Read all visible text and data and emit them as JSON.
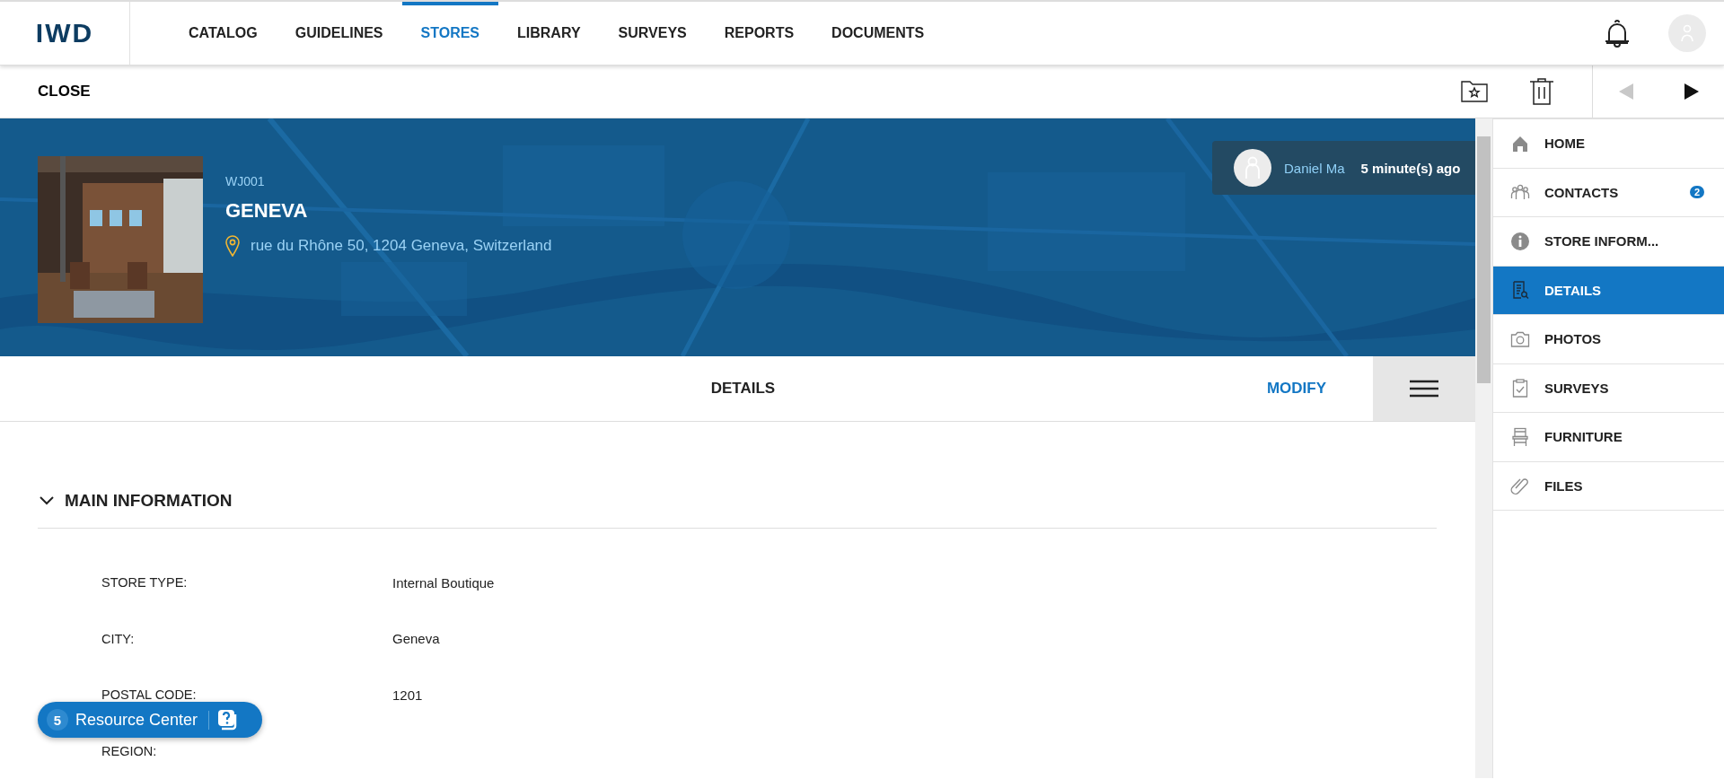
{
  "logo": "IWD",
  "nav": [
    {
      "label": "CATALOG",
      "selected": false
    },
    {
      "label": "GUIDELINES",
      "selected": false
    },
    {
      "label": "STORES",
      "selected": true
    },
    {
      "label": "LIBRARY",
      "selected": false
    },
    {
      "label": "SURVEYS",
      "selected": false
    },
    {
      "label": "REPORTS",
      "selected": false
    },
    {
      "label": "DOCUMENTS",
      "selected": false
    }
  ],
  "toolbar": {
    "close": "CLOSE",
    "previous": {
      "disabled": true
    },
    "next": {
      "disabled": false
    }
  },
  "store": {
    "code": "WJ001",
    "name": "GENEVA",
    "address": "rue du Rhône 50, 1204 Geneva, Switzerland"
  },
  "last_edit": {
    "user": "Daniel Ma",
    "time": "5 minute(s) ago"
  },
  "details_bar": {
    "title": "DETAILS",
    "modify": "MODIFY"
  },
  "section": {
    "title": "MAIN INFORMATION",
    "expanded": true,
    "fields": [
      {
        "label": "STORE TYPE:",
        "value": "Internal Boutique"
      },
      {
        "label": "CITY:",
        "value": "Geneva"
      },
      {
        "label": "POSTAL CODE:",
        "value": "1201"
      },
      {
        "label": "REGION:"
      }
    ]
  },
  "sidebar": [
    {
      "label": "HOME",
      "selected": false
    },
    {
      "label": "CONTACTS",
      "selected": false,
      "badge": "2"
    },
    {
      "label": "STORE INFORM...",
      "selected": false
    },
    {
      "label": "DETAILS",
      "selected": true
    },
    {
      "label": "PHOTOS",
      "selected": false
    },
    {
      "label": "SURVEYS",
      "selected": false
    },
    {
      "label": "FURNITURE",
      "selected": false
    },
    {
      "label": "FILES",
      "selected": false
    }
  ],
  "resource_center": {
    "count": "5",
    "label": "Resource Center"
  }
}
